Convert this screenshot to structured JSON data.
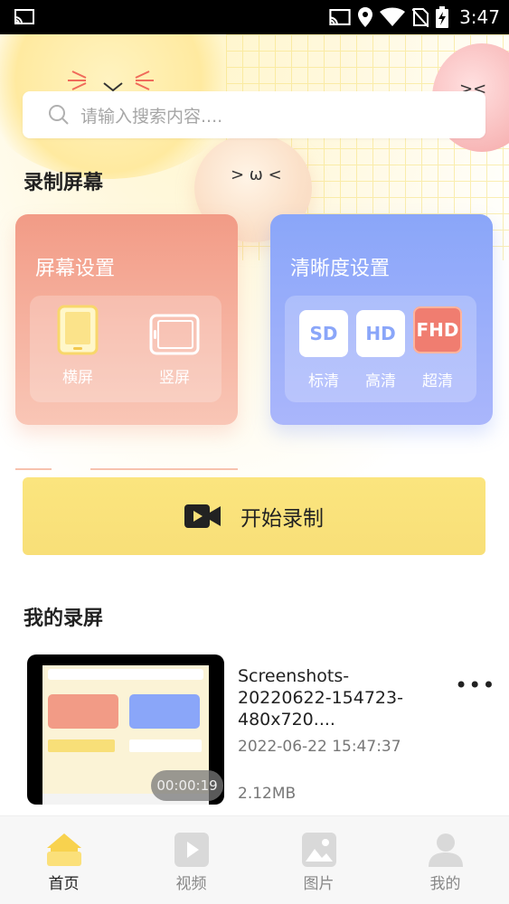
{
  "status_bar": {
    "time": "3:47"
  },
  "search": {
    "placeholder": "请输入搜索内容...."
  },
  "record_section": {
    "title": "录制屏幕",
    "screen_card": {
      "title": "屏幕设置",
      "options": [
        {
          "label": "横屏",
          "icon": "landscape-icon",
          "selected": true
        },
        {
          "label": "竖屏",
          "icon": "portrait-icon",
          "selected": false
        }
      ]
    },
    "quality_card": {
      "title": "清晰度设置",
      "options": [
        {
          "badge": "SD",
          "label": "标清"
        },
        {
          "badge": "HD",
          "label": "高清"
        },
        {
          "badge": "FHD",
          "label": "超清",
          "selected": true
        }
      ]
    },
    "start_button": {
      "label": "开始录制",
      "icon": "video-camera-icon"
    }
  },
  "recordings": {
    "title": "我的录屏",
    "items": [
      {
        "name": "Screenshots-20220622-154723-480x720....",
        "date": "2022-06-22 15:47:37",
        "size": "2.12MB",
        "duration": "00:00:19"
      }
    ]
  },
  "tabs": [
    {
      "label": "首页",
      "icon": "home-icon",
      "active": true
    },
    {
      "label": "视频",
      "icon": "video-icon",
      "active": false
    },
    {
      "label": "图片",
      "icon": "image-icon",
      "active": false
    },
    {
      "label": "我的",
      "icon": "user-icon",
      "active": false
    }
  ],
  "colors": {
    "accent_yellow": "#f8df78",
    "card_red": "#f29b86",
    "card_blue": "#8aa6f9",
    "fhd_active": "#f07d70"
  }
}
